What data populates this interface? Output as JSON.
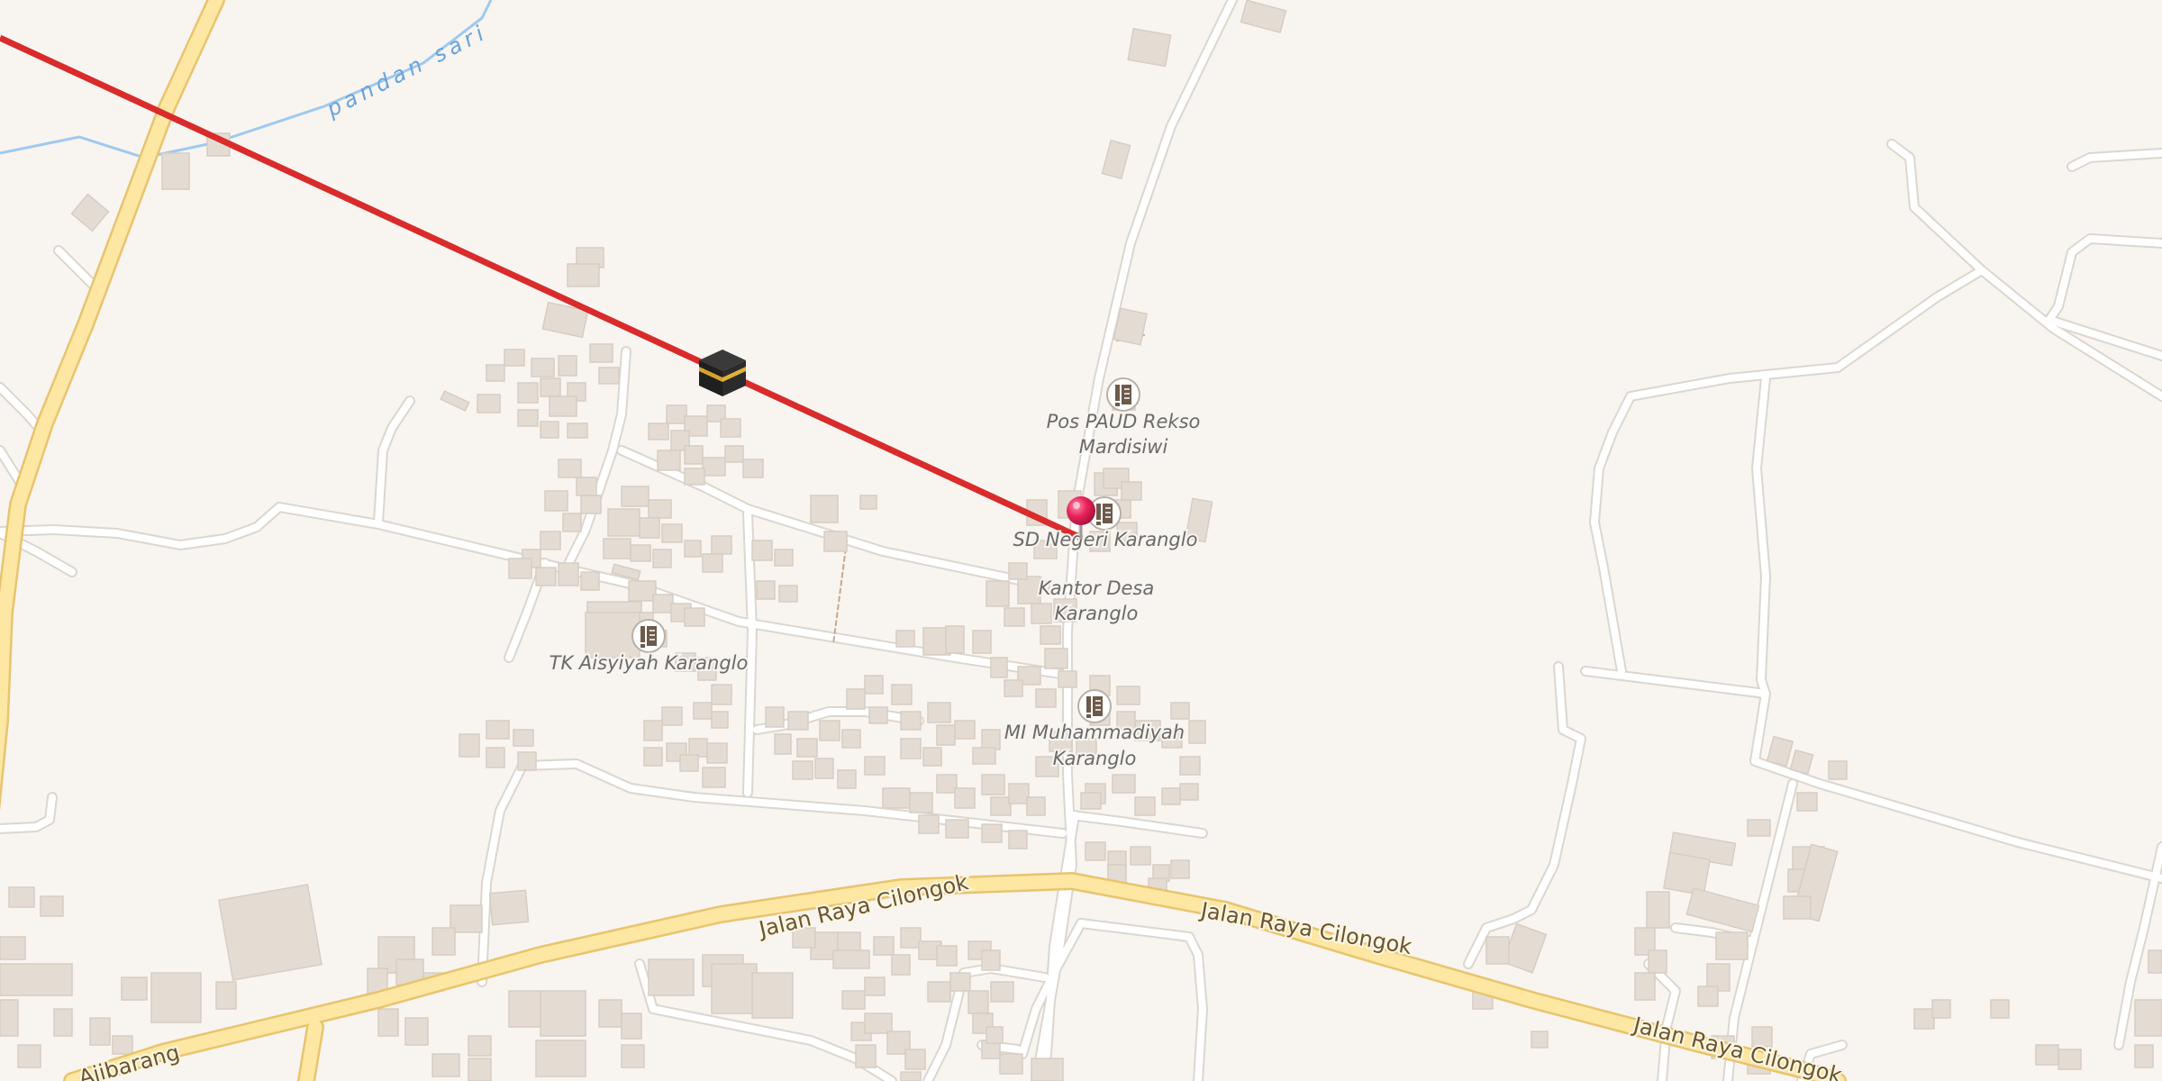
{
  "map": {
    "roads": {
      "main_1": "Jalan Raya Cilongok",
      "main_2": "Jalan Raya Cilongok",
      "main_3": "Jalan Raya Cilongok",
      "left_partial": "Ajibarang"
    },
    "waterways": {
      "river": "pandan sari"
    },
    "pois": [
      {
        "name": "Pos PAUD Rekso Mardisiwi",
        "line1": "Pos PAUD Rekso",
        "line2": "Mardisiwi",
        "icon": "school-icon"
      },
      {
        "name": "SD Negeri Karanglo",
        "line1": "SD Negeri Karanglo",
        "icon": "school-icon"
      },
      {
        "name": "Kantor Desa Karanglo",
        "line1": "Kantor Desa",
        "line2": "Karanglo"
      },
      {
        "name": "TK Aisyiyah Karanglo",
        "line1": "TK Aisyiyah Karanglo",
        "icon": "school-icon"
      },
      {
        "name": "MI Muhammadiyah Karanglo",
        "line1": "MI Muhammadiyah",
        "line2": "Karanglo",
        "icon": "school-icon"
      }
    ],
    "markers": {
      "location_pin": "map-pin-icon",
      "qibla_target": "kaaba-icon"
    },
    "overlay": {
      "qibla_line_color": "#d92b2b"
    },
    "colors": {
      "background": "#f8f4f0",
      "major_road": "#fde7a3",
      "major_road_casing": "#e8c46e",
      "minor_road": "#ffffff",
      "minor_road_casing": "#dcd6cf",
      "water": "#9ec9f0",
      "building": "#e4dcd3",
      "pin": "#e8245a"
    }
  }
}
